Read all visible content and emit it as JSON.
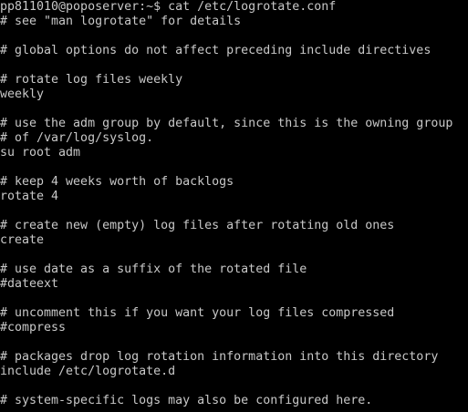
{
  "terminal": {
    "lines": [
      "pp811010@poposerver:~$ cat /etc/logrotate.conf",
      "# see \"man logrotate\" for details",
      "",
      "# global options do not affect preceding include directives",
      "",
      "# rotate log files weekly",
      "weekly",
      "",
      "# use the adm group by default, since this is the owning group",
      "# of /var/log/syslog.",
      "su root adm",
      "",
      "# keep 4 weeks worth of backlogs",
      "rotate 4",
      "",
      "# create new (empty) log files after rotating old ones",
      "create",
      "",
      "# use date as a suffix of the rotated file",
      "#dateext",
      "",
      "# uncomment this if you want your log files compressed",
      "#compress",
      "",
      "# packages drop log rotation information into this directory",
      "include /etc/logrotate.d",
      "",
      "# system-specific logs may also be configured here."
    ]
  }
}
